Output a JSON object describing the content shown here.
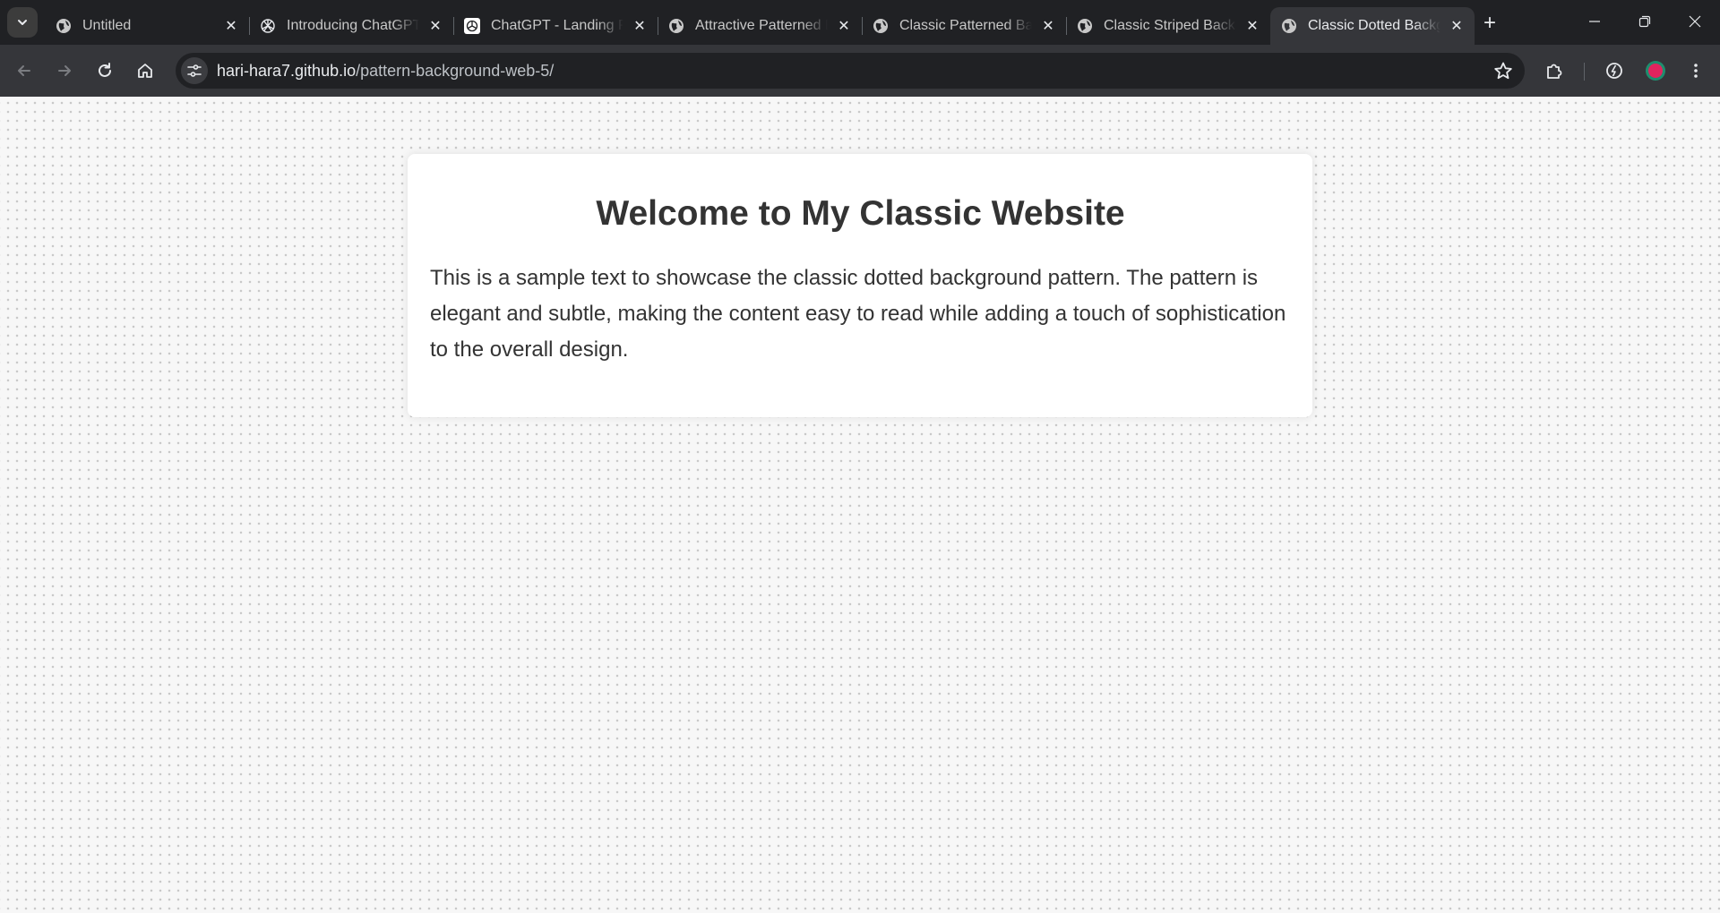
{
  "browser": {
    "tabs": [
      {
        "title": "Untitled",
        "icon": "globe-icon",
        "active": false
      },
      {
        "title": "Introducing ChatGPT",
        "icon": "openai-icon",
        "active": false
      },
      {
        "title": "ChatGPT - Landing Page",
        "icon": "openai-icon",
        "active": false
      },
      {
        "title": "Attractive Patterned Background",
        "icon": "globe-icon",
        "active": false
      },
      {
        "title": "Classic Patterned Background",
        "icon": "globe-icon",
        "active": false
      },
      {
        "title": "Classic Striped Background",
        "icon": "globe-icon",
        "active": false
      },
      {
        "title": "Classic Dotted Background",
        "icon": "globe-icon",
        "active": true
      }
    ],
    "new_tab_label": "+",
    "url_host": "hari-hara7.github.io",
    "url_path": "/pattern-background-web-5/",
    "colors": {
      "chrome_dark": "#202124",
      "toolbar": "#35363a",
      "profile_ring": "#1e8e6e",
      "profile_fill": "#e0245e"
    }
  },
  "page": {
    "heading": "Welcome to My Classic Website",
    "body": "This is a sample text to showcase the classic dotted background pattern. The pattern is elegant and subtle, making the content easy to read while adding a touch of sophistication to the overall design.",
    "colors": {
      "background": "#f7f7f7",
      "dot": "#c9c9c9",
      "card": "#ffffff",
      "text": "#333333"
    }
  }
}
